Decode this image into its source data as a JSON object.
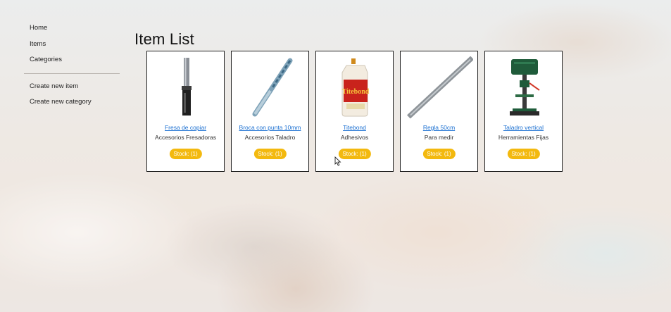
{
  "sidebar": {
    "items": [
      {
        "label": "Home"
      },
      {
        "label": "Items"
      },
      {
        "label": "Categories"
      }
    ],
    "actions": [
      {
        "label": "Create new item"
      },
      {
        "label": "Create new category"
      }
    ]
  },
  "main": {
    "title": "Item List",
    "items": [
      {
        "name": "Fresa de copiar",
        "category": "Accesorios Fresadoras",
        "stock": "Stock: (1)",
        "icon": "router-bit-icon"
      },
      {
        "name": "Broca con punta 10mm",
        "category": "Accesorios Taladro",
        "stock": "Stock: (1)",
        "icon": "drill-bit-icon"
      },
      {
        "name": "Titebond",
        "category": "Adhesivos",
        "stock": "Stock: (1)",
        "icon": "glue-bottle-icon"
      },
      {
        "name": "Regla 50cm",
        "category": "Para medir",
        "stock": "Stock: (1)",
        "icon": "ruler-icon"
      },
      {
        "name": "Taladro vertical",
        "category": "Herramientas Fijas",
        "stock": "Stock: (1)",
        "icon": "drill-press-icon"
      }
    ]
  },
  "colors": {
    "link": "#1a6fd1",
    "badge": "#f3b90f"
  }
}
